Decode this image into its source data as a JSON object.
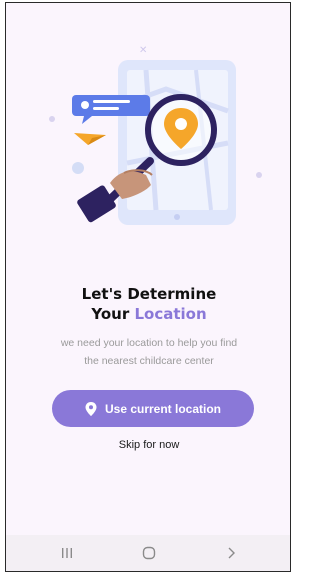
{
  "onboarding": {
    "title_line1": "Let's Determine",
    "title_your": "Your",
    "title_accent": "Location",
    "subtitle_line1": "we need your location to help you find",
    "subtitle_line2": "the nearest childcare center"
  },
  "actions": {
    "use_location_label": "Use current location",
    "skip_label": "Skip for now"
  },
  "icons": {
    "primary_button": "location-pin-icon",
    "nav_recents": "recents-icon",
    "nav_home": "home-icon",
    "nav_back": "back-icon"
  },
  "colors": {
    "accent": "#8a78d8",
    "background": "#fbf5fd",
    "pin": "#f5a62a",
    "navy": "#2d2260"
  }
}
